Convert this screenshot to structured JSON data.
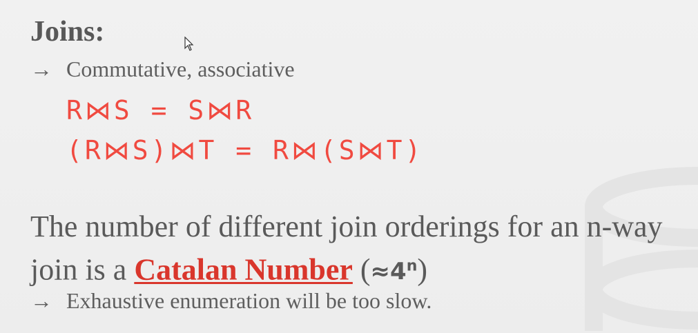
{
  "slide": {
    "heading": "Joins:",
    "bullet1": "Commutative, associative",
    "arrow": "→",
    "code_line1": "R⋈S = S⋈R",
    "code_line2": "(R⋈S)⋈T = R⋈(S⋈T)",
    "para_text_before": "The number of different join orderings for an n-way join is a ",
    "catalan_link": "Catalan Number",
    "approx_open": " (",
    "approx_value": "≈4",
    "approx_exp": "n",
    "approx_close": ")",
    "bullet2": "Exhaustive enumeration will be too slow."
  },
  "colors": {
    "accent_red": "#f04a40",
    "link_red": "#d9362c",
    "text_gray": "#5e5e5e",
    "background": "#efefef"
  },
  "icons": [
    "cursor-icon",
    "database-watermark-icon"
  ]
}
